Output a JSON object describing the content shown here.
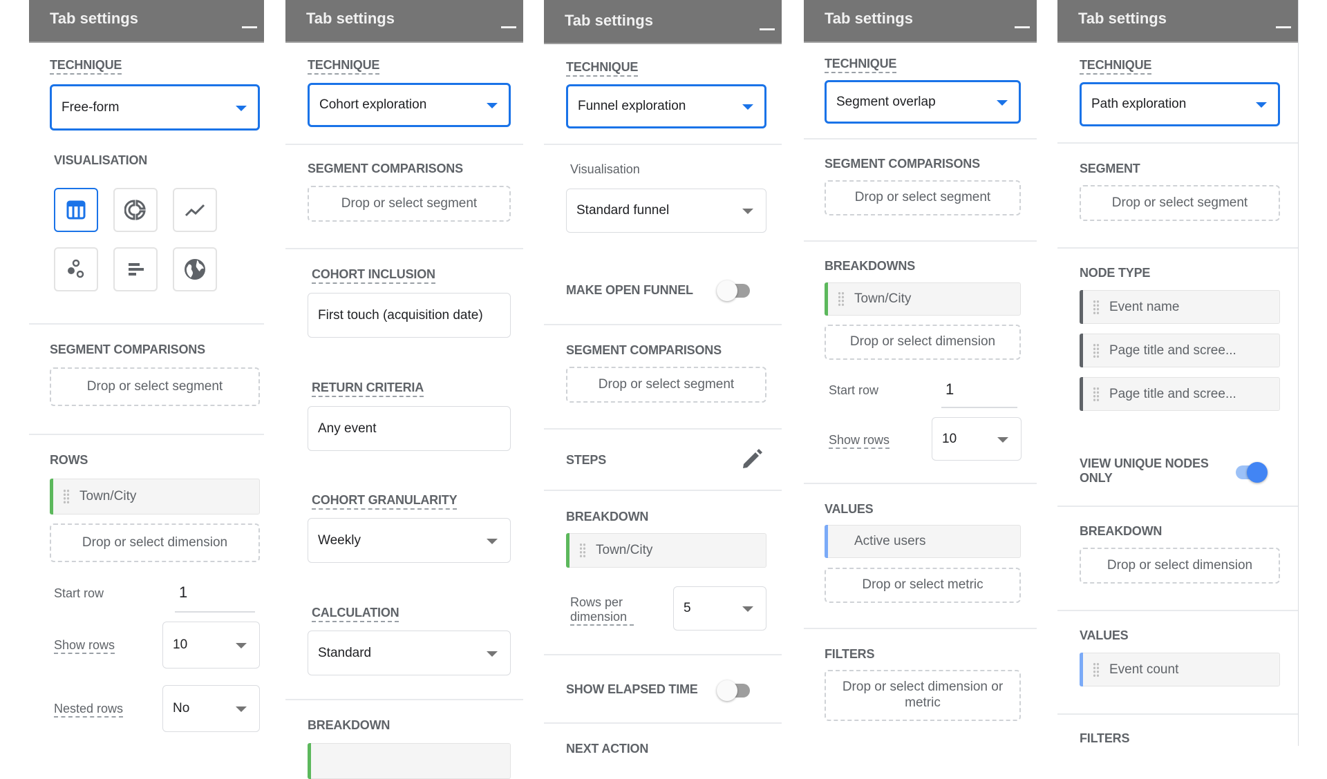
{
  "colors": {
    "header_bg": "#757575",
    "accent_blue": "#1a73e8",
    "dimension_green": "#5cb85c",
    "metric_blue": "#7baaf7",
    "node_dark": "#5f6368"
  },
  "panels": [
    {
      "header": {
        "title": "Tab settings",
        "minimize_label": "Minimise"
      },
      "technique": {
        "label": "TECHNIQUE",
        "value": "Free-form"
      },
      "visualisation": {
        "label": "VISUALISATION",
        "options": [
          {
            "icon": "table-icon",
            "selected": true
          },
          {
            "icon": "donut-chart-icon",
            "selected": false
          },
          {
            "icon": "line-chart-icon",
            "selected": false
          },
          {
            "icon": "scatter-plot-icon",
            "selected": false
          },
          {
            "icon": "bar-chart-icon",
            "selected": false
          },
          {
            "icon": "geo-map-icon",
            "selected": false
          }
        ]
      },
      "segment_comparisons": {
        "label": "SEGMENT COMPARISONS",
        "placeholder": "Drop or select segment"
      },
      "rows": {
        "label": "ROWS",
        "items": [
          "Town/City"
        ],
        "placeholder": "Drop or select dimension",
        "start_row_label": "Start row",
        "start_row_value": "1",
        "show_rows_label": "Show rows",
        "show_rows_value": "10",
        "nested_rows_label": "Nested rows",
        "nested_rows_value": "No"
      }
    },
    {
      "header": {
        "title": "Tab settings",
        "minimize_label": "Minimise"
      },
      "technique": {
        "label": "TECHNIQUE",
        "value": "Cohort exploration"
      },
      "segment_comparisons": {
        "label": "SEGMENT COMPARISONS",
        "placeholder": "Drop or select segment"
      },
      "cohort_inclusion": {
        "label": "COHORT INCLUSION",
        "value": "First touch (acquisition date)"
      },
      "return_criteria": {
        "label": "RETURN CRITERIA",
        "value": "Any event"
      },
      "cohort_granularity": {
        "label": "COHORT GRANULARITY",
        "value": "Weekly"
      },
      "calculation": {
        "label": "CALCULATION",
        "value": "Standard"
      },
      "breakdown": {
        "label": "BREAKDOWN"
      }
    },
    {
      "header": {
        "title": "Tab settings",
        "minimize_label": "Minimise"
      },
      "technique": {
        "label": "TECHNIQUE",
        "value": "Funnel exploration"
      },
      "visualisation": {
        "label": "Visualisation",
        "value": "Standard funnel"
      },
      "make_open_funnel": {
        "label": "MAKE OPEN FUNNEL",
        "on": false
      },
      "segment_comparisons": {
        "label": "SEGMENT COMPARISONS",
        "placeholder": "Drop or select segment"
      },
      "steps": {
        "label": "STEPS",
        "edit_icon": "pencil-icon"
      },
      "breakdown": {
        "label": "BREAKDOWN",
        "items": [
          "Town/City"
        ],
        "rows_per_dimension_label": "Rows per dimension",
        "rows_per_dimension_value": "5"
      },
      "show_elapsed_time": {
        "label": "SHOW ELAPSED TIME",
        "on": false
      },
      "next_action": {
        "label": "NEXT ACTION"
      }
    },
    {
      "header": {
        "title": "Tab settings",
        "minimize_label": "Minimise"
      },
      "technique": {
        "label": "TECHNIQUE",
        "value": "Segment overlap"
      },
      "segment_comparisons": {
        "label": "SEGMENT COMPARISONS",
        "placeholder": "Drop or select segment"
      },
      "breakdowns": {
        "label": "BREAKDOWNS",
        "items": [
          "Town/City"
        ],
        "placeholder": "Drop or select dimension",
        "start_row_label": "Start row",
        "start_row_value": "1",
        "show_rows_label": "Show rows",
        "show_rows_value": "10"
      },
      "values": {
        "label": "VALUES",
        "items": [
          "Active users"
        ],
        "placeholder": "Drop or select metric"
      },
      "filters": {
        "label": "FILTERS",
        "placeholder": "Drop or select dimension or metric"
      }
    },
    {
      "header": {
        "title": "Tab settings",
        "minimize_label": "Minimise"
      },
      "technique": {
        "label": "TECHNIQUE",
        "value": "Path exploration"
      },
      "segment": {
        "label": "SEGMENT",
        "placeholder": "Drop or select segment"
      },
      "node_type": {
        "label": "NODE TYPE",
        "items": [
          "Event name",
          "Page title and scree...",
          "Page title and scree..."
        ]
      },
      "view_unique_nodes": {
        "label": "VIEW UNIQUE NODES ONLY",
        "on": true
      },
      "breakdown": {
        "label": "BREAKDOWN",
        "placeholder": "Drop or select dimension"
      },
      "values": {
        "label": "VALUES",
        "items": [
          "Event count"
        ]
      },
      "filters": {
        "label": "FILTERS"
      }
    }
  ]
}
